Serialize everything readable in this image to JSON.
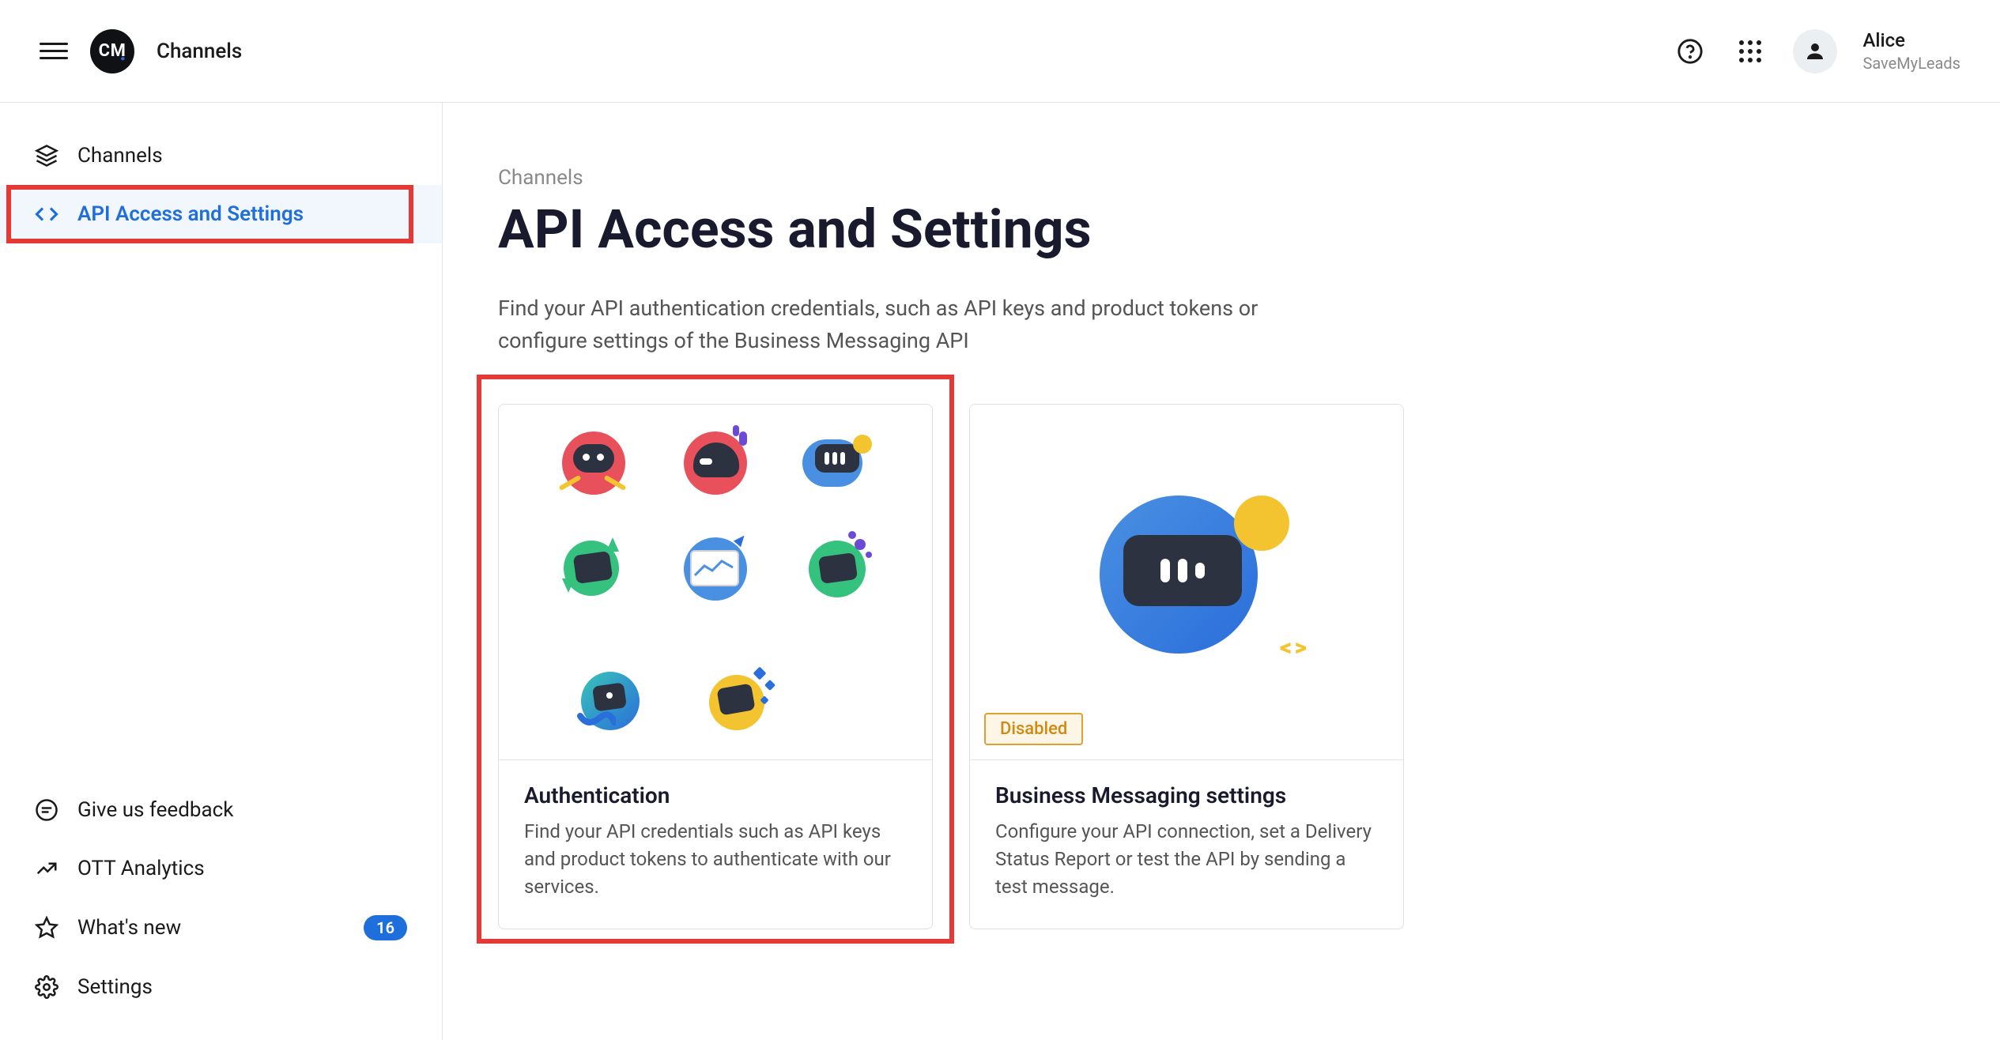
{
  "header": {
    "app_name": "Channels",
    "user_name": "Alice",
    "user_org": "SaveMyLeads"
  },
  "sidebar": {
    "top": [
      {
        "label": "Channels"
      },
      {
        "label": "API Access and Settings"
      }
    ],
    "bottom": [
      {
        "label": "Give us feedback"
      },
      {
        "label": "OTT Analytics"
      },
      {
        "label": "What's new",
        "badge": "16"
      },
      {
        "label": "Settings"
      }
    ]
  },
  "main": {
    "breadcrumb": "Channels",
    "title": "API Access and Settings",
    "description": "Find your API authentication credentials, such as API keys and product tokens or configure settings of the Business Messaging API",
    "cards": [
      {
        "title": "Authentication",
        "description": "Find your API credentials such as API keys and product tokens to authenticate with our services."
      },
      {
        "title": "Business Messaging settings",
        "description": "Configure your API connection, set a Delivery Status Report or test the API by sending a test message.",
        "status": "Disabled"
      }
    ]
  }
}
